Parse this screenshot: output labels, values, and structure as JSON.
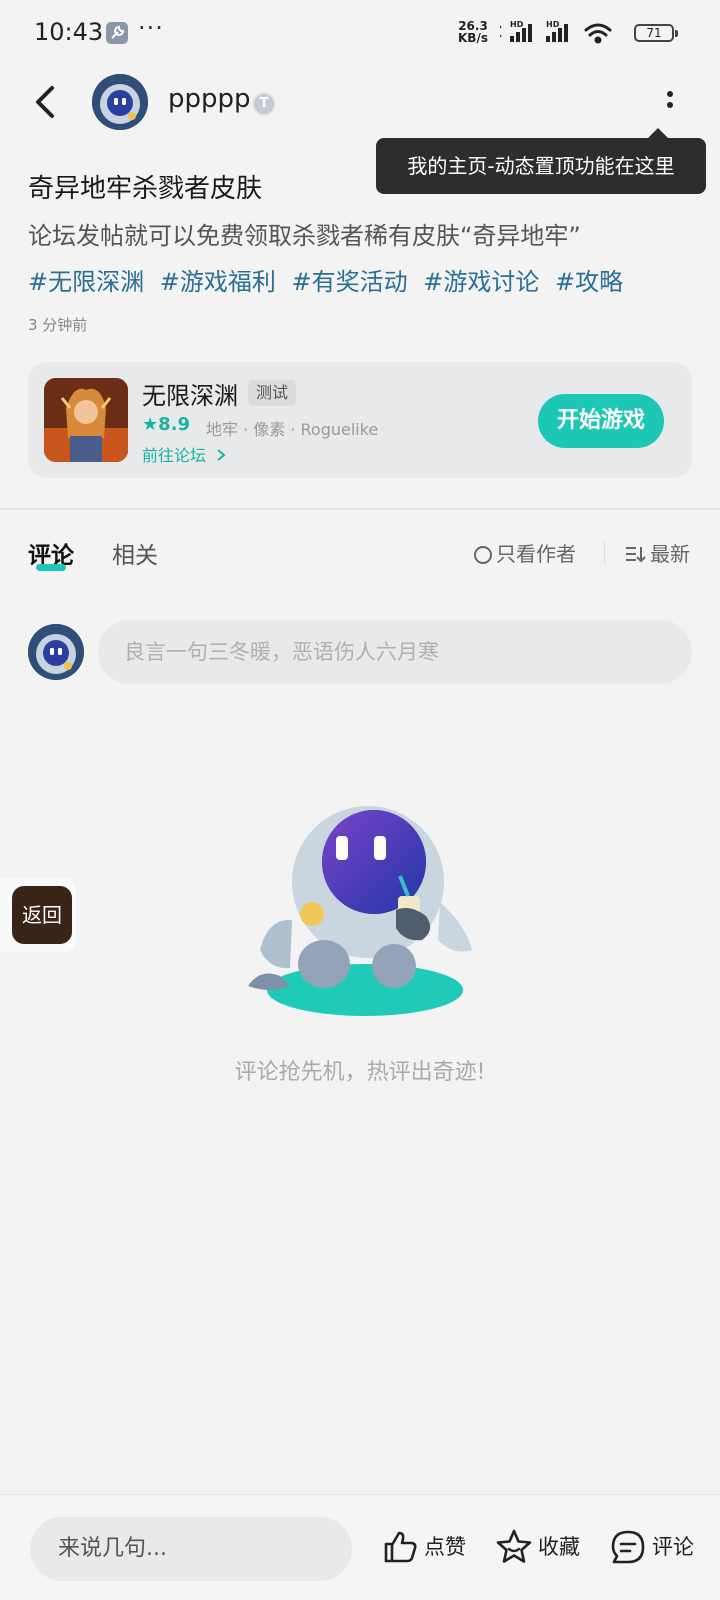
{
  "status_bar": {
    "time": "10:43",
    "speed_value": "26.3",
    "speed_unit": "KB/s",
    "battery": "71",
    "icons": [
      "wrench-icon",
      "bluetooth-icon",
      "signal-hd-icon",
      "signal-hd-icon",
      "wifi-icon",
      "battery-icon"
    ]
  },
  "header": {
    "author_name": "ppppp",
    "verify_badge": "T",
    "tooltip": "我的主页-动态置顶功能在这里"
  },
  "post": {
    "title": "奇异地牢杀戮者皮肤",
    "body": "论坛发帖就可以免费领取杀戮者稀有皮肤“奇异地牢”",
    "tags": [
      "#无限深渊",
      "#游戏福利",
      "#有奖活动",
      "#游戏讨论",
      "#攻略"
    ],
    "time": "3 分钟前"
  },
  "game": {
    "name": "无限深渊",
    "badge": "测试",
    "rating": "8.9",
    "genres": "地牢 · 像素 · Roguelike",
    "forum_link": "前往论坛",
    "play_button": "开始游戏"
  },
  "tabs": {
    "comment": "评论",
    "related": "相关",
    "author_only": "只看作者",
    "sort": "最新"
  },
  "comment_input": {
    "placeholder": "良言一句三冬暖，恶语伤人六月寒"
  },
  "empty_state": {
    "text": "评论抢先机，热评出奇迹!"
  },
  "float_back": {
    "label": "返回"
  },
  "bottom_bar": {
    "input_placeholder": "来说几句...",
    "like": "点赞",
    "favorite": "收藏",
    "comment": "评论"
  },
  "colors": {
    "accent": "#1dc7b5",
    "tag": "#2a6f96",
    "tooltip_bg": "#2d2d2d"
  }
}
